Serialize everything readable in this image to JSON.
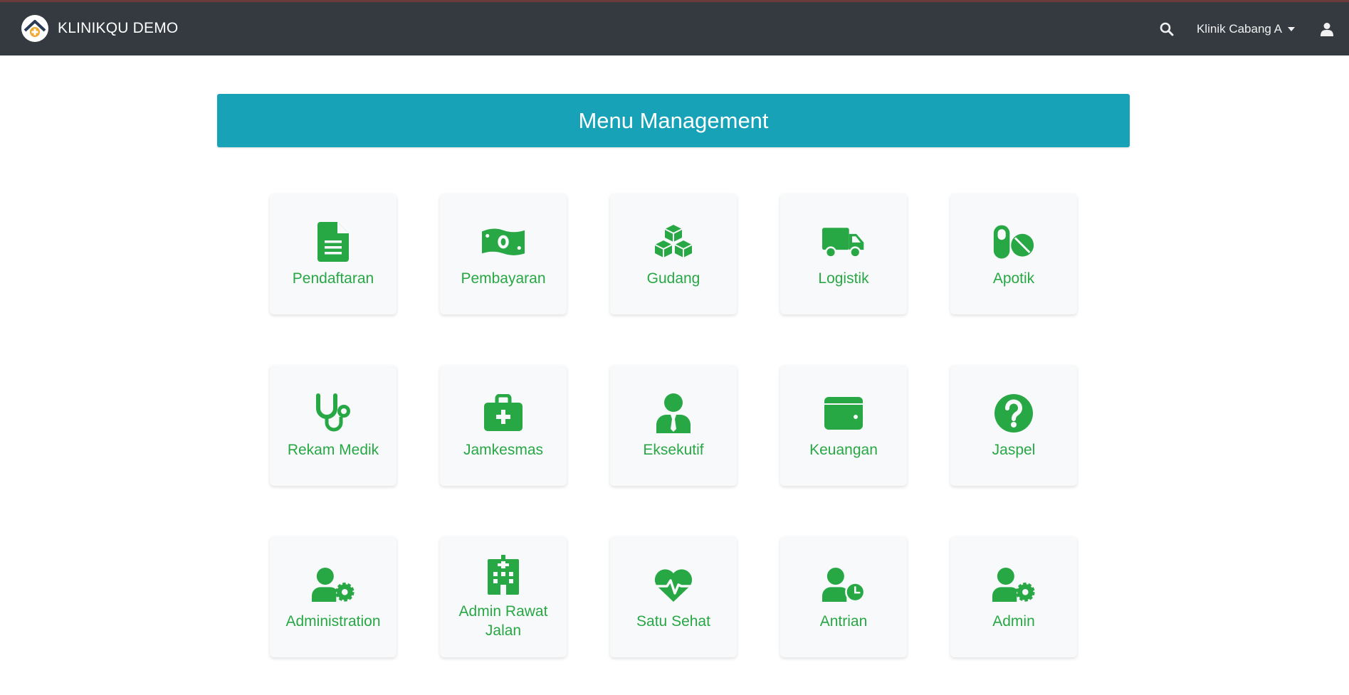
{
  "navbar": {
    "brand": "KLINIKQU DEMO",
    "branch": "Klinik Cabang A",
    "icons": {
      "logo": "clinic-logo-icon",
      "search": "search-icon",
      "user": "user-icon"
    }
  },
  "header": {
    "title": "Menu Management"
  },
  "colors": {
    "accent": "#17a2b8",
    "icon_green": "#28a745",
    "navbar_bg": "#343a40"
  },
  "menu": [
    {
      "label": "Pendaftaran",
      "icon": "file-icon"
    },
    {
      "label": "Pembayaran",
      "icon": "money-bill-icon"
    },
    {
      "label": "Gudang",
      "icon": "cubes-icon"
    },
    {
      "label": "Logistik",
      "icon": "truck-icon"
    },
    {
      "label": "Apotik",
      "icon": "pills-icon"
    },
    {
      "label": "Rekam Medik",
      "icon": "stethoscope-icon"
    },
    {
      "label": "Jamkesmas",
      "icon": "medkit-icon"
    },
    {
      "label": "Eksekutif",
      "icon": "user-tie-icon"
    },
    {
      "label": "Keuangan",
      "icon": "wallet-icon"
    },
    {
      "label": "Jaspel",
      "icon": "question-circle-icon"
    },
    {
      "label": "Administration",
      "icon": "user-cog-icon"
    },
    {
      "label": "Admin Rawat Jalan",
      "icon": "hospital-icon"
    },
    {
      "label": "Satu Sehat",
      "icon": "heartbeat-icon"
    },
    {
      "label": "Antrian",
      "icon": "user-clock-icon"
    },
    {
      "label": "Admin",
      "icon": "user-cog-icon"
    }
  ]
}
